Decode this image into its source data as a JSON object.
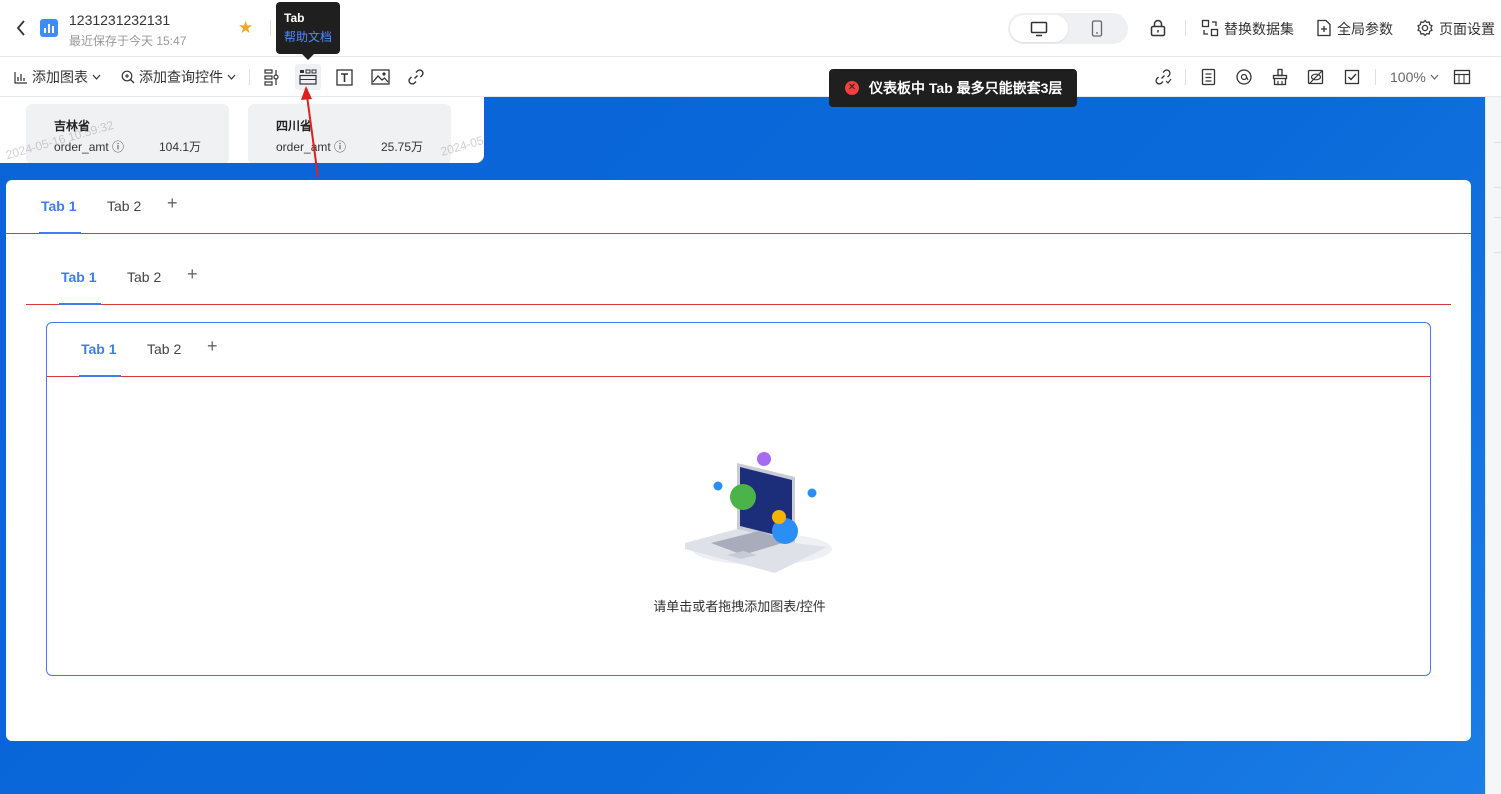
{
  "header": {
    "title": "1231231232131",
    "subtitle": "最近保存于今天 15:47",
    "actions": {
      "replace_dataset": "替换数据集",
      "global_params": "全局参数",
      "page_settings": "页面设置"
    }
  },
  "toolbar": {
    "add_chart": "添加图表",
    "add_query_control": "添加查询控件",
    "zoom": "100%"
  },
  "tooltip": {
    "title": "Tab",
    "link": "帮助文档"
  },
  "toast": {
    "message": "仪表板中 Tab 最多只能嵌套3层"
  },
  "kpi_cards": [
    {
      "province": "吉林省",
      "metric": "order_amt",
      "value": "104.1万"
    },
    {
      "province": "四川省",
      "metric": "order_amt",
      "value": "25.75万"
    }
  ],
  "watermarks": [
    "2024-05-16 10:59:32",
    "2024-05"
  ],
  "tabs_level1": {
    "items": [
      "Tab 1",
      "Tab 2"
    ],
    "active": 0,
    "add": "+"
  },
  "tabs_level2": {
    "items": [
      "Tab 1",
      "Tab 2"
    ],
    "active": 0,
    "add": "+"
  },
  "tabs_level3": {
    "items": [
      "Tab 1",
      "Tab 2"
    ],
    "active": 0,
    "add": "+"
  },
  "empty_state": {
    "text": "请单击或者拖拽添加图表/控件"
  },
  "colors": {
    "accent": "#3f7ef0",
    "canvas_bg": "#0b63d8",
    "error": "#f0413e",
    "star": "#f5a623",
    "tab_divider": "#d9363e"
  },
  "icons": {
    "back": "chevron-left-icon",
    "logo": "bar-chart-icon",
    "favorite": "star-icon",
    "desktop": "monitor-icon",
    "mobile": "phone-icon",
    "lock": "lock-icon",
    "dataset": "dataset-icon",
    "params": "params-icon",
    "settings": "gear-icon",
    "error": "error-circle-icon"
  }
}
